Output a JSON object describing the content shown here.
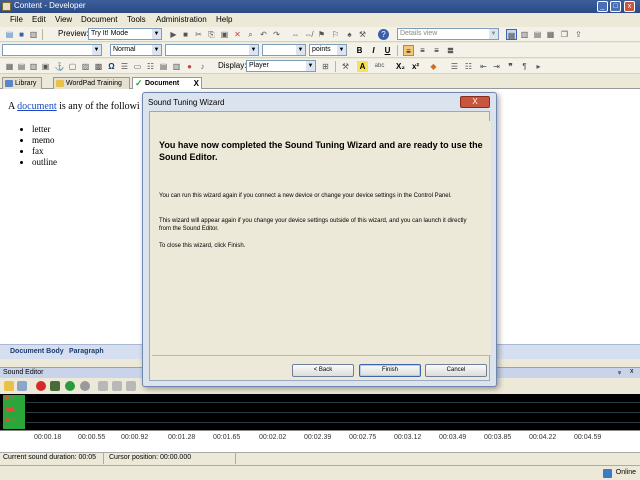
{
  "window": {
    "title": "Content - Developer",
    "minimize": "_",
    "maximize": "□",
    "close": "x"
  },
  "menu": [
    "File",
    "Edit",
    "View",
    "Document",
    "Tools",
    "Administration",
    "Help"
  ],
  "toolbar1": {
    "preview_label": "Preview:",
    "preview_value": "Try It! Mode",
    "view_combo": "Details view"
  },
  "toolbar2": {
    "style_value": "Normal",
    "font_value": "",
    "size_value": "",
    "units_value": "points",
    "bold": "B",
    "italic": "I",
    "underline": "U"
  },
  "toolbar3": {
    "display_label": "Display:",
    "display_value": "Player",
    "superscript": "x²",
    "subscript": "X₂",
    "abc": "abc"
  },
  "tabs": [
    {
      "label": "Library",
      "icon": "library-icon"
    },
    {
      "label": "WordPad Training",
      "icon": "wordpad-icon"
    },
    {
      "label": "Document",
      "icon": "document-check-icon",
      "close": "X"
    }
  ],
  "document": {
    "lead_before": "A ",
    "lead_link": "document",
    "lead_after": " is any of the followi",
    "items": [
      "letter",
      "memo",
      "fax",
      "outline"
    ]
  },
  "doc_status": {
    "left": "Document Body",
    "right": "Paragraph"
  },
  "sound_editor": {
    "title": "Sound Editor",
    "pin": "ᵩ",
    "close": "x",
    "levels": [
      "-6.0",
      "-Inf.",
      "-6.0"
    ],
    "ticks": [
      "00:00.18",
      "00:00.55",
      "00:00.92",
      "00:01.28",
      "00:01.65",
      "00:02.02",
      "00:02.39",
      "00:02.75",
      "00:03.12",
      "00:03.49",
      "00:03.85",
      "00:04.22",
      "00:04.59"
    ],
    "duration": "Current sound duration: 00:05",
    "cursor": "Cursor position: 00:00.000"
  },
  "app_status": {
    "online": "Online"
  },
  "dialog": {
    "title": "Sound Tuning Wizard",
    "close": "X",
    "heading": "You have now completed the Sound Tuning Wizard and are ready to use the Sound Editor.",
    "para1": "You can run this wizard again if you connect a new device or change your device settings in the Control Panel.",
    "para2": "This wizard will appear again if you change your device settings outside of this wizard, and you can launch it directly from the Sound Editor.",
    "para3": "To close this wizard, click Finish.",
    "back": "< Back",
    "finish": "Finish",
    "cancel": "Cancel"
  },
  "colors": {
    "title_bar": "#2b4a86",
    "dialog_bg": "#dbe3ef",
    "close_red": "#c8563e",
    "link": "#1a48c4",
    "level_green": "#2aa63a"
  }
}
